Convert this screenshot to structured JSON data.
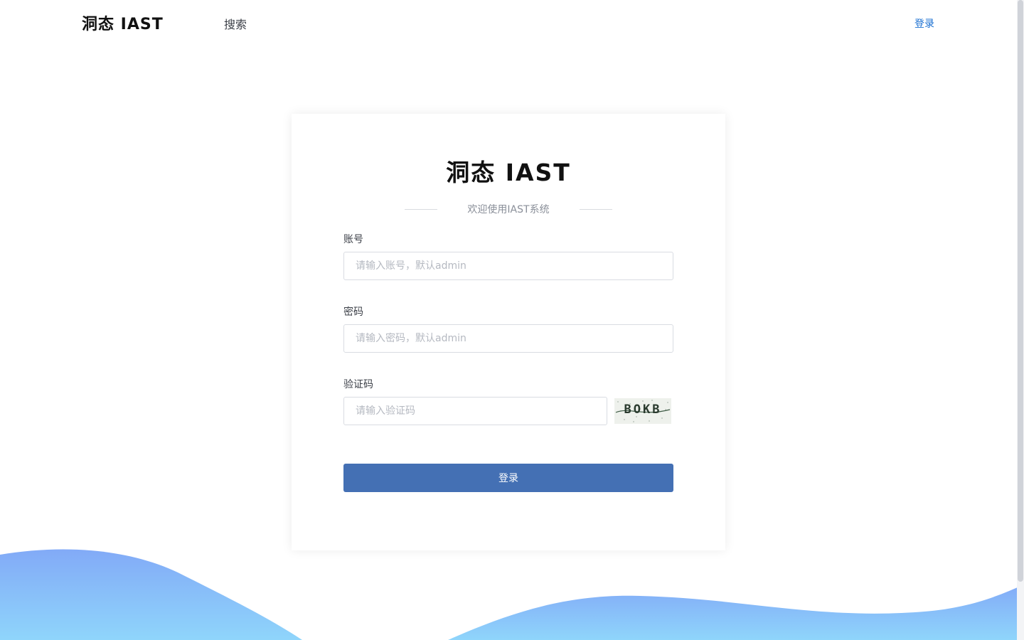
{
  "header": {
    "brand": "洞态 IAST",
    "nav_search": "搜索",
    "nav_login": "登录"
  },
  "login": {
    "logo": "洞态 IAST",
    "welcome": "欢迎使用IAST系统",
    "account_label": "账号",
    "account_placeholder": "请输入账号，默认admin",
    "password_label": "密码",
    "password_placeholder": "请输入密码，默认admin",
    "captcha_label": "验证码",
    "captcha_placeholder": "请输入验证码",
    "captcha_text": "BOKB",
    "submit_label": "登录"
  },
  "colors": {
    "accent": "#4470b4",
    "link": "#1a6fd1",
    "wave_top": "#82aaf7",
    "wave_bottom": "#8fd5fb"
  }
}
